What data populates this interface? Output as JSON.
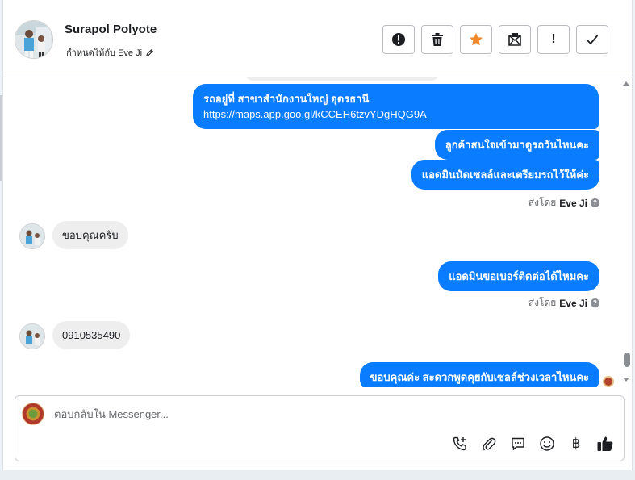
{
  "header": {
    "contact_name": "Surapol Polyote",
    "assigned_label": "กำหนดให้กับ Eve Ji",
    "actions": [
      {
        "name": "mark-spam-button",
        "icon": "alert-circle-icon"
      },
      {
        "name": "delete-button",
        "icon": "trash-icon"
      },
      {
        "name": "star-button",
        "icon": "star-icon"
      },
      {
        "name": "mark-unread-button",
        "icon": "envelope-icon"
      },
      {
        "name": "mark-important-button",
        "icon": "exclamation-icon",
        "label": "!"
      },
      {
        "name": "mark-done-button",
        "icon": "check-icon"
      }
    ]
  },
  "messages": {
    "out1_line1": "รถอยู่ที่ สาขาสำนักงานใหญ่ อุดรธานี",
    "out1_link": "https://maps.app.goo.gl/kCCEH6tzvYDgHQG9A",
    "out2": "ลูกค้าสนใจเข้ามาดูรถวันไหนคะ",
    "out3": "แอดมินนัดเซลล์และเตรียมรถไว้ให้ค่ะ",
    "sent_by_1_prefix": "ส่งโดย",
    "sent_by_1_name": "Eve Ji",
    "in1": "ขอบคุณครับ",
    "out4": "แอดมินขอเบอร์ติดต่อได้ไหมคะ",
    "sent_by_2_prefix": "ส่งโดย",
    "sent_by_2_name": "Eve Ji",
    "in2": "0910535490",
    "out5": "ขอบคุณค่ะ สะดวกพูดคุยกับเซลล์ช่วงเวลาไหนคะ"
  },
  "composer": {
    "placeholder": "ตอบกลับใน Messenger...",
    "tools": [
      "phone-add-icon",
      "paperclip-icon",
      "chat-bubble-icon",
      "emoji-icon",
      "baht-icon",
      "thumbs-up-icon"
    ],
    "baht_symbol": "฿"
  },
  "colors": {
    "outgoing_bubble": "#0a7cff",
    "incoming_bubble": "#eeeeef"
  }
}
